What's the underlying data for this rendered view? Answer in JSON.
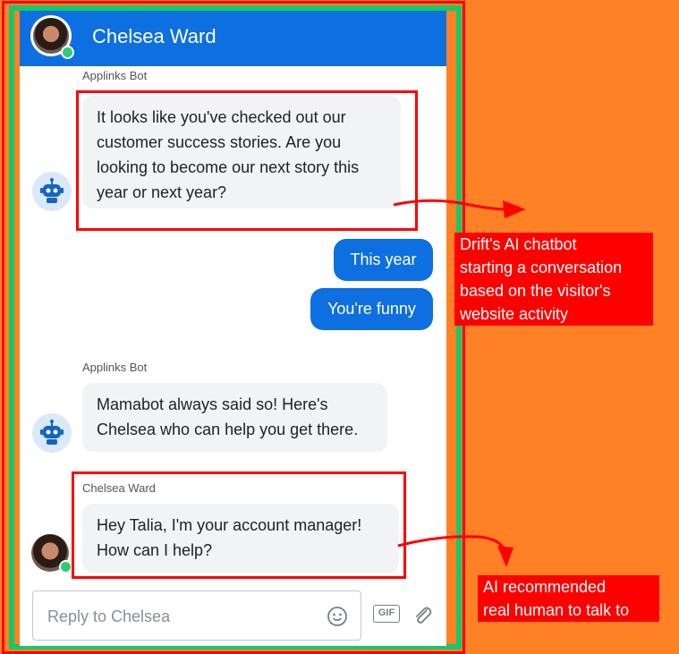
{
  "header": {
    "name": "Chelsea Ward"
  },
  "messages": {
    "bot1_sender": "Applinks Bot",
    "bot1_text": "It looks like you've checked out our\ncustomer success stories. Are you\nlooking to become our next story this\nyear or next year?",
    "user1_text": "This year",
    "user2_text": "You're funny",
    "bot2_sender": "Applinks Bot",
    "bot2_text": "Mamabot always said so! Here's\nChelsea who can help you get there.",
    "agent_sender": "Chelsea Ward",
    "agent_text": "Hey Talia, I'm your account manager!\nHow can I help?"
  },
  "composer": {
    "placeholder": "Reply to Chelsea",
    "gif_label": "GIF"
  },
  "annotations": {
    "callout1": "Drift's AI chatbot\nstarting a conversation\nbased on the visitor's\nwebsite activity",
    "callout2": "AI recommended\nreal human to talk to"
  },
  "colors": {
    "background": "#ff8126",
    "header": "#0d6fe0",
    "user_bubble": "#0d6fe0",
    "highlight": "#ff0000",
    "frame_green": "#14c96a"
  },
  "icons": {
    "bot": "robot-icon",
    "emoji": "emoji-icon",
    "gif": "gif-icon",
    "attach": "paperclip-icon"
  }
}
